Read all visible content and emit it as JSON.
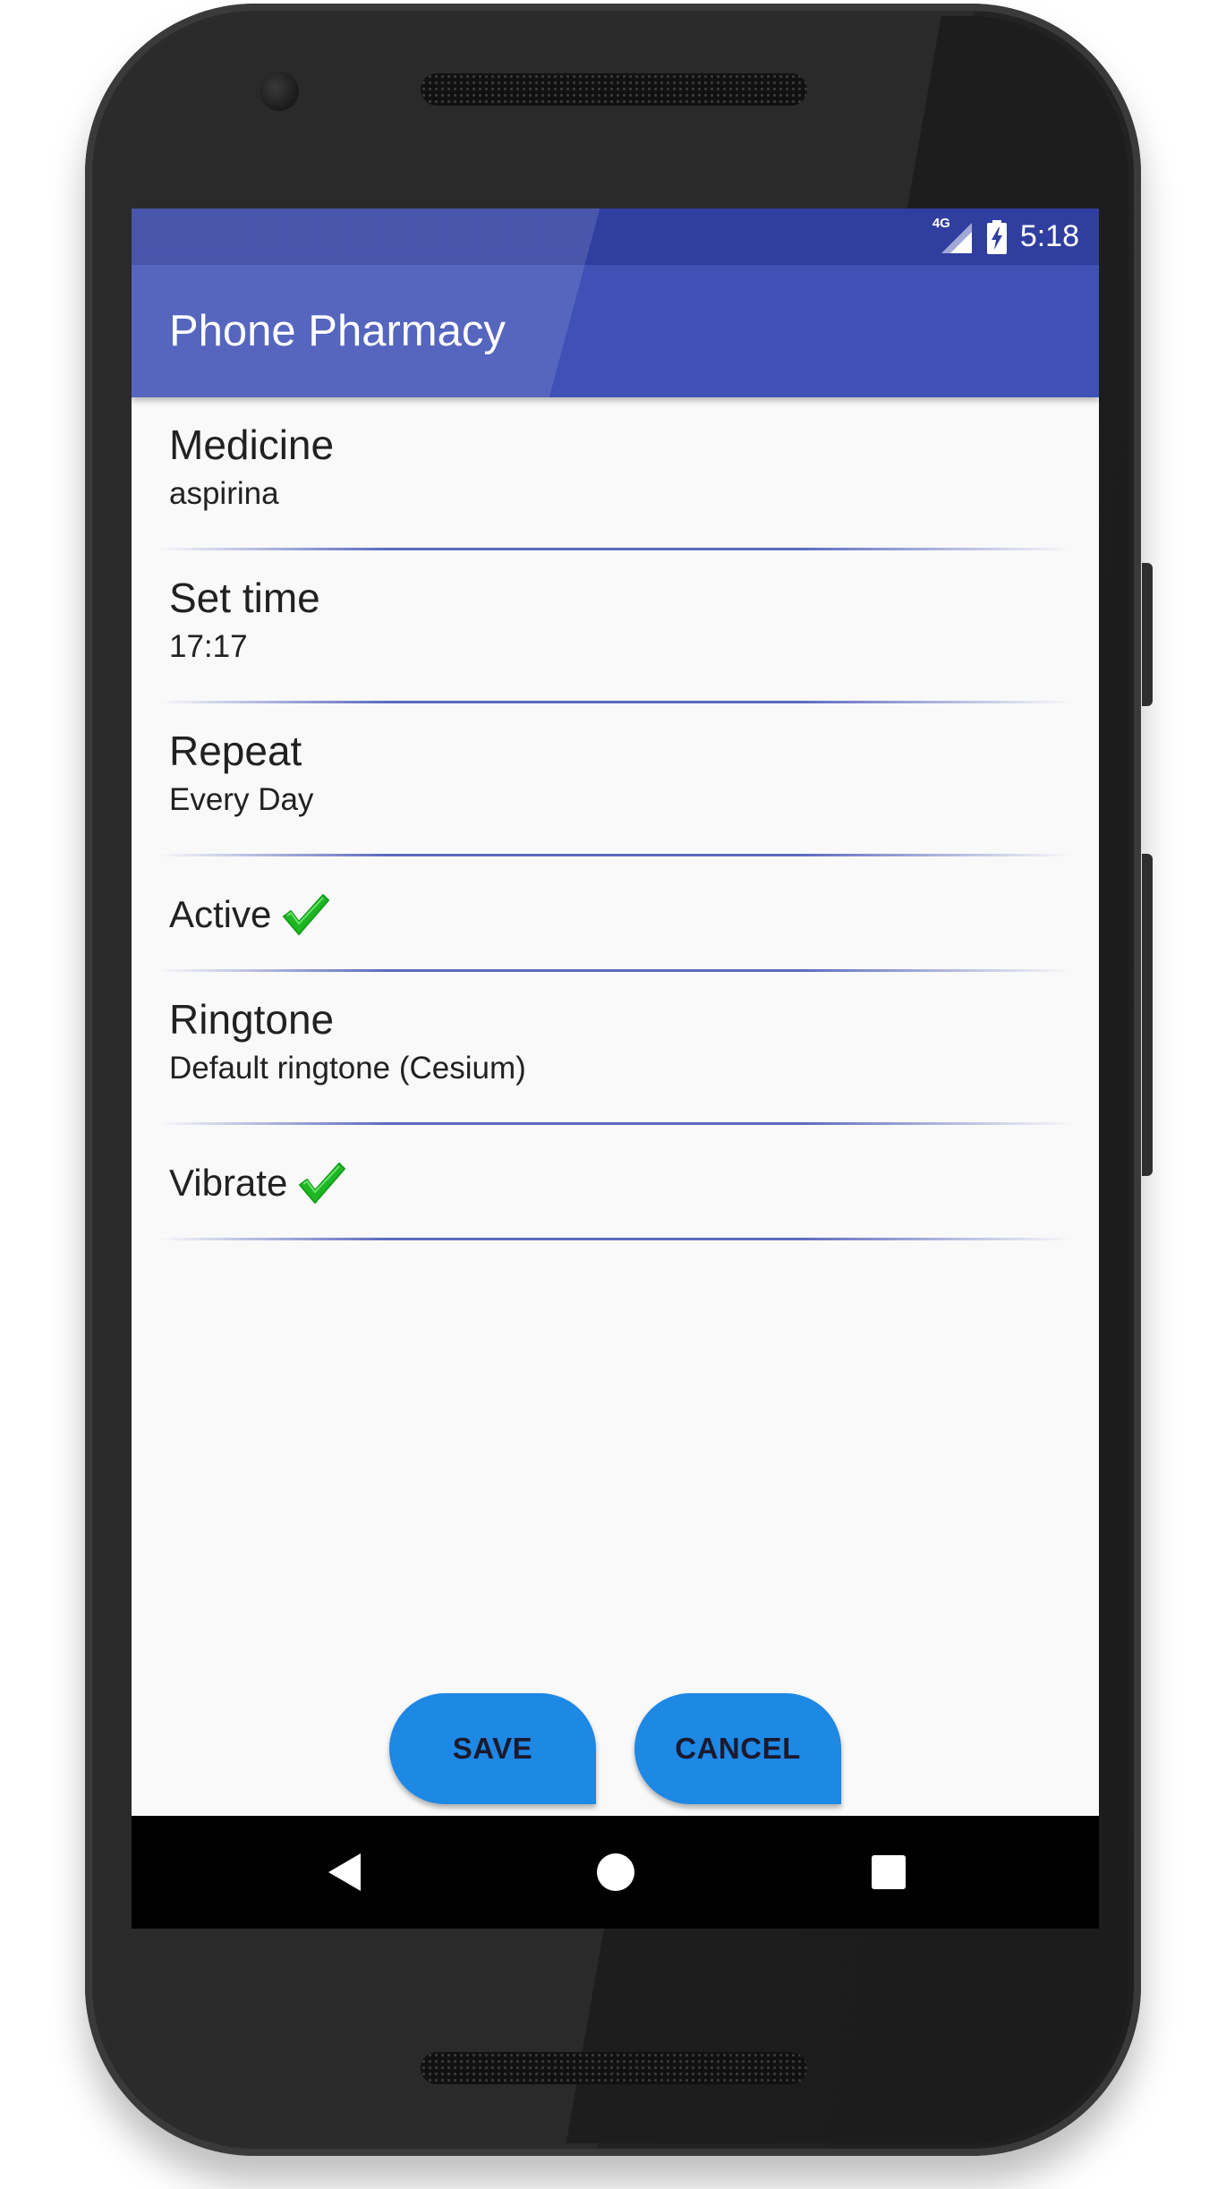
{
  "status_bar": {
    "network": "4G",
    "time": "5:18"
  },
  "app_bar": {
    "title": "Phone Pharmacy"
  },
  "settings": {
    "medicine": {
      "label": "Medicine",
      "value": "aspirina"
    },
    "set_time": {
      "label": "Set time",
      "value": "17:17"
    },
    "repeat": {
      "label": "Repeat",
      "value": "Every Day"
    },
    "active": {
      "label": "Active",
      "checked": true
    },
    "ringtone": {
      "label": "Ringtone",
      "value": "Default ringtone (Cesium)"
    },
    "vibrate": {
      "label": "Vibrate",
      "checked": true
    }
  },
  "actions": {
    "save_label": "SAVE",
    "cancel_label": "CANCEL"
  },
  "nav": {
    "icons": [
      "back-icon",
      "home-icon",
      "recents-icon"
    ]
  },
  "colors": {
    "primary": "#3f51b5",
    "primary_dark": "#303f9f",
    "accent_button": "#1e88e5",
    "check_green": "#22c02a"
  }
}
